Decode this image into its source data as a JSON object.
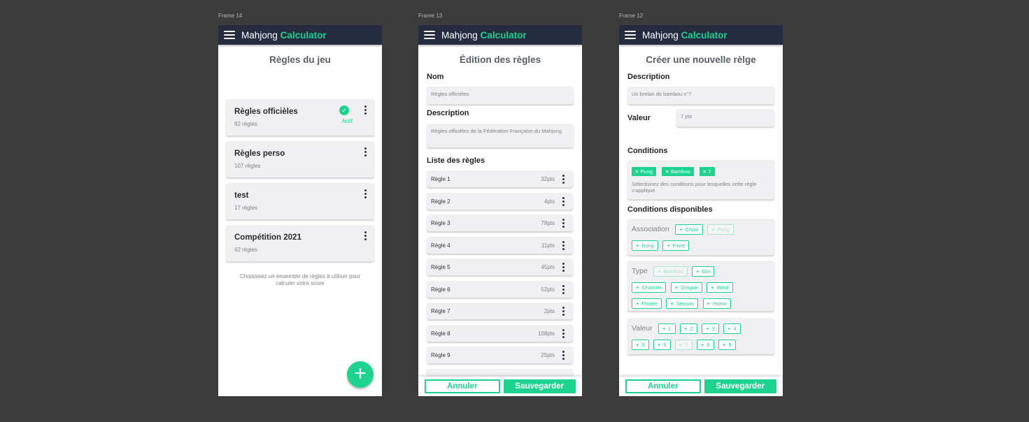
{
  "app": {
    "title_plain": "Mahjong",
    "title_accent": "Calculator",
    "accent_color": "#1ed38f",
    "bar_color": "#262c40"
  },
  "frame14": {
    "label": "Frame 14",
    "title": "Règles du jeu",
    "cards": [
      {
        "name": "Règles officièles",
        "count": "82 règles",
        "active": true
      },
      {
        "name": "Règles perso",
        "count": "107 règles",
        "active": false
      },
      {
        "name": "test",
        "count": "17 règles",
        "active": false
      },
      {
        "name": "Compétition 2021",
        "count": "62 règles",
        "active": false
      }
    ],
    "active_label": "Actif",
    "help": "Choisissez un ensemble de règles à utiliser pour calculer votre score",
    "fab": "+"
  },
  "frame13": {
    "label": "Frame 13",
    "title": "Édition des règles",
    "name_label": "Nom",
    "name_value": "Règles officiéles",
    "desc_label": "Description",
    "desc_value": "Règles officièles de la Fédération Française du Mahjong",
    "list_label": "Liste des règles",
    "rules": [
      {
        "name": "Règle 1",
        "pts": "32pts"
      },
      {
        "name": "Règle 2",
        "pts": "4pts"
      },
      {
        "name": "Règle 3",
        "pts": "78pts"
      },
      {
        "name": "Règle 4",
        "pts": "11pts"
      },
      {
        "name": "Règle 5",
        "pts": "45pts"
      },
      {
        "name": "Règle 6",
        "pts": "52pts"
      },
      {
        "name": "Règle 7",
        "pts": "2pts"
      },
      {
        "name": "Règle 8",
        "pts": "108pts"
      },
      {
        "name": "Règle 9",
        "pts": "25pts"
      }
    ],
    "cancel": "Annuler",
    "save": "Sauvegarder"
  },
  "frame12": {
    "label": "Frame 12",
    "title": "Créer une nouvelle rèlge",
    "desc_label": "Description",
    "desc_value": "Un brelan de bambou n°7",
    "value_label": "Valeur",
    "value_value": "7 pts",
    "conditions_label": "Conditions",
    "selected": [
      "Pung",
      "Bamboo",
      "7"
    ],
    "cond_hint": "Sélectionez des conditions pour lesquelles cette règle s'applique",
    "available_label": "Conditions disponibles",
    "groups": {
      "association": {
        "label": "Association",
        "chips": [
          "Chow",
          "Pung",
          "Kong",
          "Paire"
        ]
      },
      "type": {
        "label": "Type",
        "chips": [
          "Bamboo",
          "Dot",
          "Charcter",
          "Dragon",
          "Wind",
          "Flower",
          "Season",
          "Honor"
        ]
      },
      "valeur": {
        "label": "Valeur",
        "chips": [
          "1",
          "2",
          "3",
          "4",
          "5",
          "6",
          "7",
          "8",
          "9"
        ]
      }
    },
    "cancel": "Annuler",
    "save": "Sauvegarder"
  }
}
